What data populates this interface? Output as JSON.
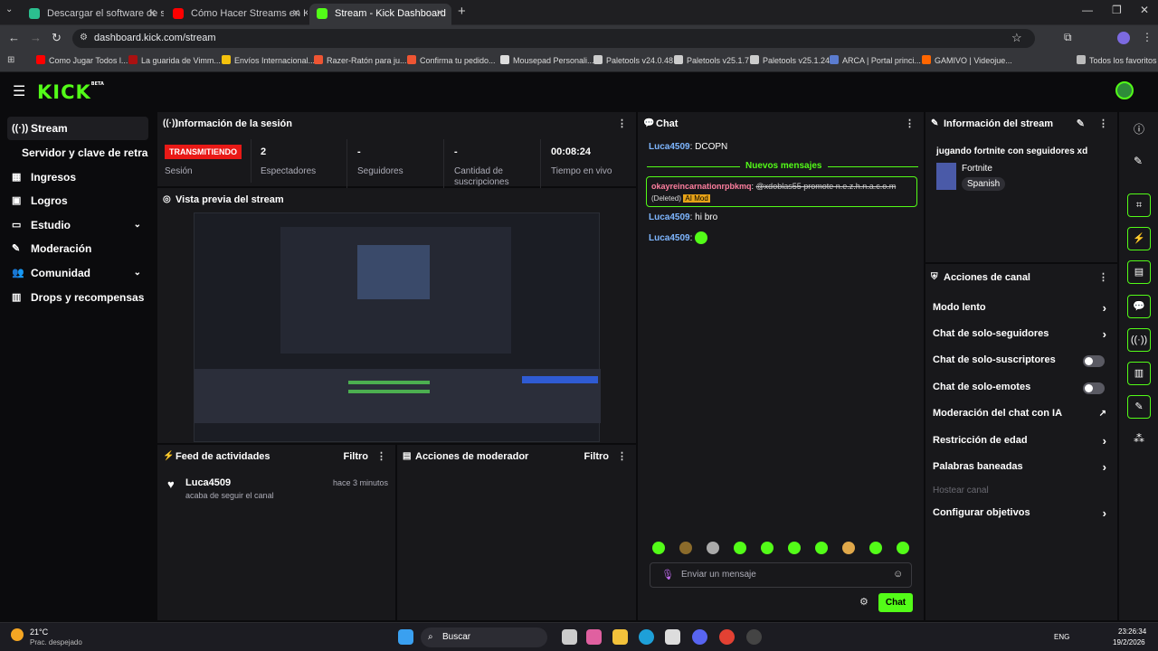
{
  "browser": {
    "tabs": [
      {
        "title": "Descargar el software de strea",
        "color": "#2bbf8f"
      },
      {
        "title": "Cómo Hacer Streams en Kick (C",
        "color": "#ff0000"
      },
      {
        "title": "Stream - Kick Dashboard",
        "color": "#53fc18"
      }
    ],
    "url": "dashboard.kick.com/stream",
    "bookmarks": [
      "Como Jugar Todos l...",
      "La guarida de Vimm...",
      "Envíos Internacional...",
      "Razer-Ratón para ju...",
      "Confirma tu pedido...",
      "Mousepad Personali...",
      "Paletools v24.0.48",
      "Paletools v25.1.7",
      "Paletools v25.1.24",
      "ARCA | Portal princi...",
      "GAMIVO | Videojue..."
    ],
    "all_bookmarks": "Todos los favoritos"
  },
  "app": {
    "logo": "KICK",
    "logo_beta": "BETA",
    "sidebar": [
      {
        "label": "Stream",
        "icon": "((·))"
      },
      {
        "label": "Servidor y clave de retransmisión",
        "icon": ""
      },
      {
        "label": "Ingresos",
        "icon": "▦"
      },
      {
        "label": "Logros",
        "icon": "▣"
      },
      {
        "label": "Estudio",
        "icon": "▭",
        "chev": "⌄"
      },
      {
        "label": "Moderación",
        "icon": "✎"
      },
      {
        "label": "Comunidad",
        "icon": "👥",
        "chev": "⌄"
      },
      {
        "label": "Drops y recompensas",
        "icon": "▥"
      }
    ],
    "session": {
      "title": "Información de la sesión",
      "status": "TRANSMITIENDO",
      "status_label": "Sesión",
      "stats": [
        {
          "value": "2",
          "label": "Espectadores"
        },
        {
          "value": "-",
          "label": "Seguidores"
        },
        {
          "value": "-",
          "label": "Cantidad de suscripciones"
        },
        {
          "value": "00:08:24",
          "label": "Tiempo en vivo"
        }
      ]
    },
    "preview": {
      "title": "Vista previa del stream"
    },
    "activity": {
      "title": "Feed de actividades",
      "filter": "Filtro",
      "user": "Luca4509",
      "action": "acaba de seguir el canal",
      "time": "hace 3 minutos"
    },
    "modactions": {
      "title": "Acciones de moderador",
      "filter": "Filtro"
    },
    "chat": {
      "title": "Chat",
      "new_messages": "Nuevos mensajes",
      "messages": [
        {
          "user": "Luca4509",
          "text": "DCOPN"
        },
        {
          "user": "Luca4509",
          "text": "hi bro"
        },
        {
          "user": "Luca4509",
          "text": ""
        }
      ],
      "deleted": {
        "user": "okayreincarnationrpbkmq",
        "text": "@xdoblas55 promote n.e.z.h.n.a.c.o.m",
        "tag": "(Deleted)",
        "badge": "AI Mod"
      },
      "input_placeholder": "Enviar un mensaje",
      "send": "Chat"
    },
    "stream_info": {
      "title": "Información del stream",
      "stream_title": "jugando fortnite con seguidores xd",
      "game": "Fortnite",
      "language": "Spanish"
    },
    "channel_actions": {
      "title": "Acciones de canal",
      "items": [
        {
          "label": "Modo lento",
          "kind": "arrow"
        },
        {
          "label": "Chat de solo-seguidores",
          "kind": "arrow"
        },
        {
          "label": "Chat de solo-suscriptores",
          "kind": "toggle"
        },
        {
          "label": "Chat de solo-emotes",
          "kind": "toggle"
        },
        {
          "label": "Moderación del chat con IA",
          "kind": "ext"
        },
        {
          "label": "Restricción de edad",
          "kind": "arrow"
        },
        {
          "label": "Palabras baneadas",
          "kind": "arrow"
        },
        {
          "label": "Hostear canal",
          "kind": "disabled"
        },
        {
          "label": "Configurar objetivos",
          "kind": "arrow"
        }
      ]
    }
  },
  "taskbar": {
    "weather": "21°C",
    "weather_desc": "Prac. despejado",
    "search": "Buscar",
    "lang": "ENG",
    "time": "23:26:34",
    "date": "19/2/2026"
  }
}
